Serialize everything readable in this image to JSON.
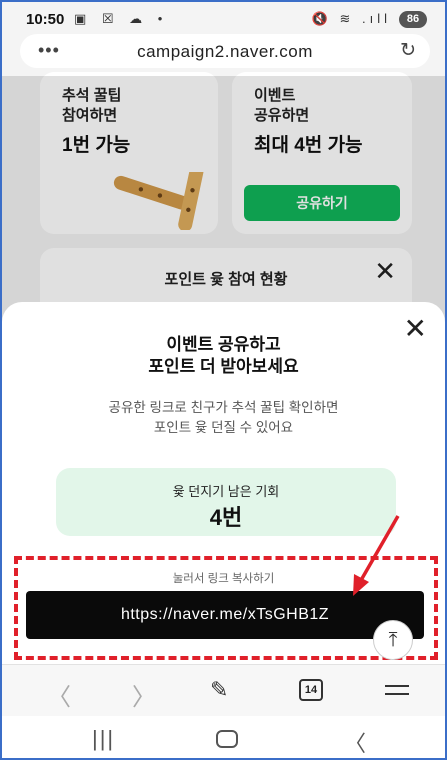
{
  "status_bar": {
    "time": "10:50",
    "left_icons": "▣ ☒ ☁ •",
    "right_icons": "🔇 ≋ .ıll",
    "battery": "86"
  },
  "url_bar": {
    "menu_icon": "•••",
    "url": "campaign2.naver.com",
    "reload_icon": "↻"
  },
  "background_page": {
    "card1": {
      "subtitle": "추석 꿀팁\n참여하면",
      "big": "1번 가능"
    },
    "card2": {
      "subtitle": "이벤트\n공유하면",
      "big": "최대 4번 가능",
      "button": "공유하기"
    },
    "card3": {
      "title": "포인트 윷 참여 현황",
      "close": "✕"
    }
  },
  "sheet": {
    "close": "✕",
    "title_line1": "이벤트 공유하고",
    "title_line2": "포인트 더 받아보세요",
    "desc_line1": "공유한 링크로 친구가 추석 꿀팁 확인하면",
    "desc_line2": "포인트 윷 던질 수 있어요",
    "chance_label": "윷 던지기 남은 기회",
    "chance_count": "4번",
    "copy_label": "눌러서 링크 복사하기",
    "copy_link": "https://naver.me/xTsGHB1Z",
    "scroll_top": "⤒"
  },
  "browser_toolbar": {
    "back": "〈",
    "forward": "〉",
    "home": "✎",
    "tabs": "14"
  },
  "system_nav": {
    "recent": "|||",
    "back": "〈"
  },
  "colors": {
    "green": "#10b55a",
    "annotation_red": "#e0202a",
    "mint": "#e2f6e9"
  }
}
